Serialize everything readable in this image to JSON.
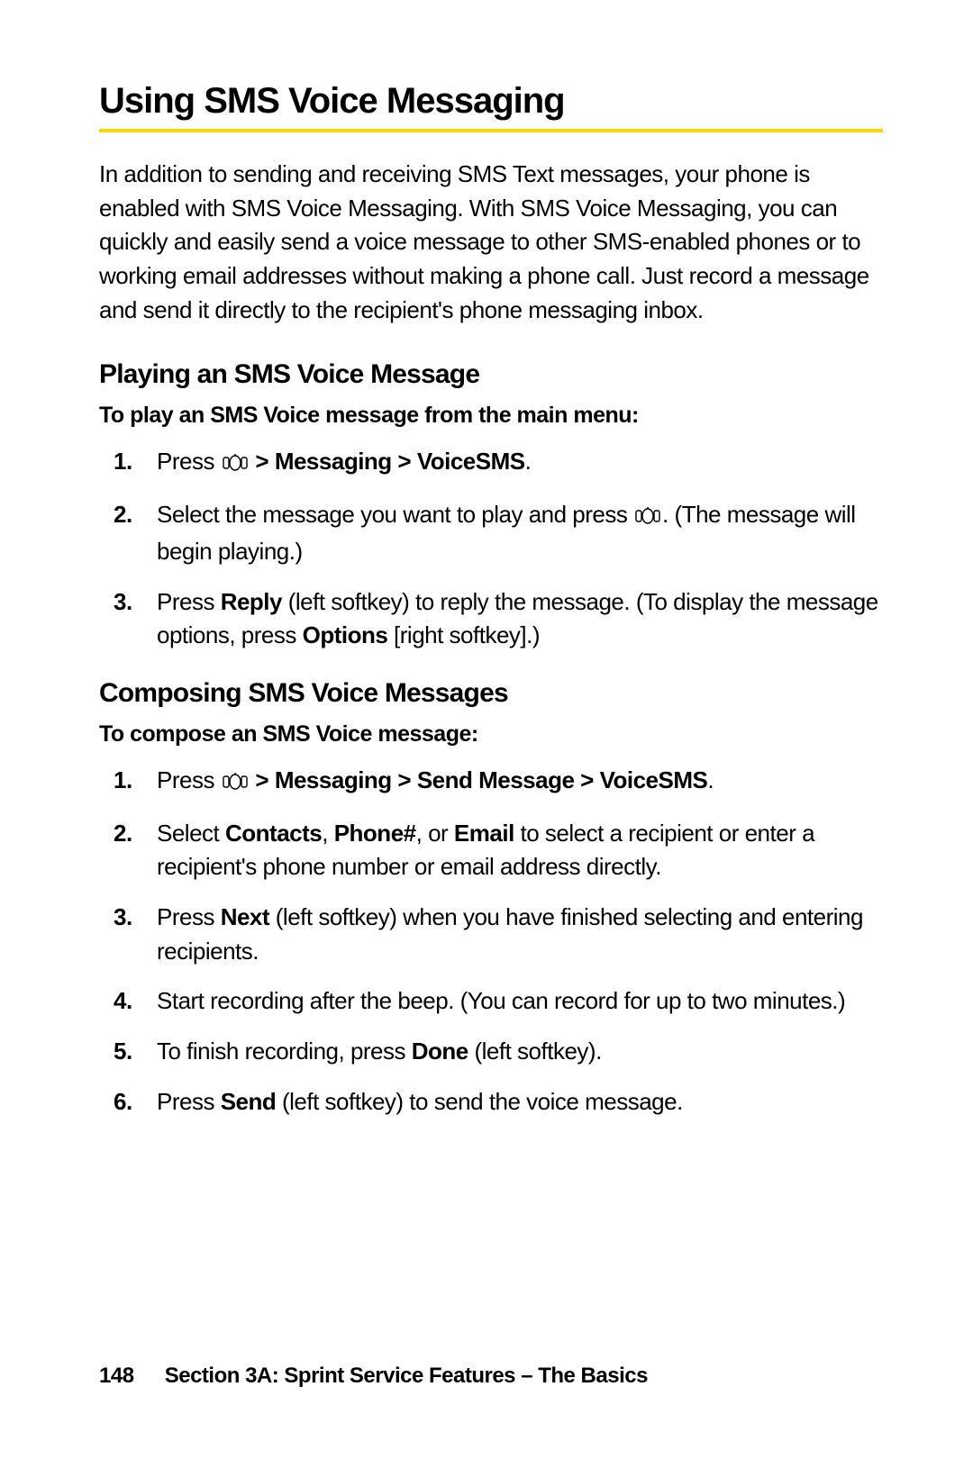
{
  "title": "Using SMS Voice Messaging",
  "intro": "In addition to sending and receiving SMS Text messages, your phone is enabled with SMS Voice Messaging. With SMS Voice Messaging, you can quickly and easily send a voice message to other SMS-enabled phones or to working email addresses without making a phone call. Just record a message and send it directly to the recipient's phone messaging inbox.",
  "play": {
    "heading": "Playing an SMS Voice Message",
    "label": "To play an SMS Voice message from the main menu:",
    "steps": {
      "s1": {
        "num": "1.",
        "pre": "Press ",
        "path": " > Messaging > VoiceSMS",
        "post": "."
      },
      "s2": {
        "num": "2.",
        "a": "Select the message you want to play and press ",
        "b": ". (The message will begin playing.)"
      },
      "s3": {
        "num": "3.",
        "a": "Press ",
        "reply": "Reply",
        "b": " (left softkey) to reply the message. (To display the message options, press ",
        "options": "Options",
        "c": " [right softkey].)"
      }
    }
  },
  "compose": {
    "heading": "Composing SMS Voice Messages",
    "label": "To compose an SMS Voice message:",
    "steps": {
      "s1": {
        "num": "1.",
        "pre": "Press ",
        "path": " > Messaging > Send Message > VoiceSMS",
        "post": "."
      },
      "s2": {
        "num": "2.",
        "a": "Select ",
        "contacts": "Contacts",
        "comma": ", ",
        "phone": "Phone#",
        "or": ", or ",
        "email": "Email",
        "b": " to select a recipient or enter a recipient's phone number or email address directly."
      },
      "s3": {
        "num": "3.",
        "a": "Press ",
        "next": "Next",
        "b": " (left softkey) when you have finished selecting and entering recipients."
      },
      "s4": {
        "num": "4.",
        "txt": "Start recording after the beep. (You can record for up to two minutes.)"
      },
      "s5": {
        "num": "5.",
        "a": "To finish recording, press ",
        "done": "Done",
        "b": " (left softkey)."
      },
      "s6": {
        "num": "6.",
        "a": "Press ",
        "send": "Send",
        "b": " (left softkey) to send the voice message."
      }
    }
  },
  "footer": {
    "page": "148",
    "text": "Section 3A: Sprint Service Features – The Basics"
  }
}
